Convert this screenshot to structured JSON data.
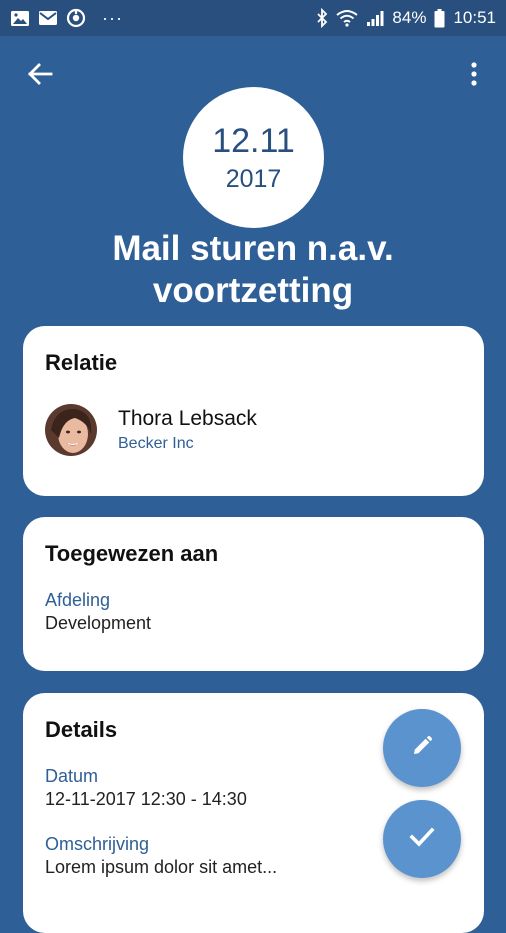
{
  "status_bar": {
    "battery": "84%",
    "time": "10:51",
    "overflow": "···",
    "icons": [
      "gallery-icon",
      "mail-icon",
      "sync-icon",
      "bluetooth-icon",
      "wifi-icon",
      "signal-icon",
      "battery-icon"
    ]
  },
  "header": {
    "back_icon": "arrow-left-icon",
    "menu_icon": "more-vertical-icon",
    "date_day": "12.11",
    "date_year": "2017",
    "title": "Mail sturen n.a.v. voortzetting"
  },
  "relatie": {
    "heading": "Relatie",
    "name": "Thora Lebsack",
    "company": "Becker Inc"
  },
  "toegewezen": {
    "heading": "Toegewezen aan",
    "label": "Afdeling",
    "value": "Development"
  },
  "details": {
    "heading": "Details",
    "datum_label": "Datum",
    "datum_value": "12-11-2017 12:30 - 14:30",
    "omschrijving_label": "Omschrijving",
    "omschrijving_value": "Lorem ipsum dolor sit amet..."
  },
  "fabs": {
    "edit_icon": "pencil-icon",
    "complete_icon": "check-icon"
  },
  "colors": {
    "background": "#2e5f96",
    "status_bar": "#284f7e",
    "accent": "#2e5f96",
    "fab": "#5b93cf",
    "card": "#ffffff"
  }
}
